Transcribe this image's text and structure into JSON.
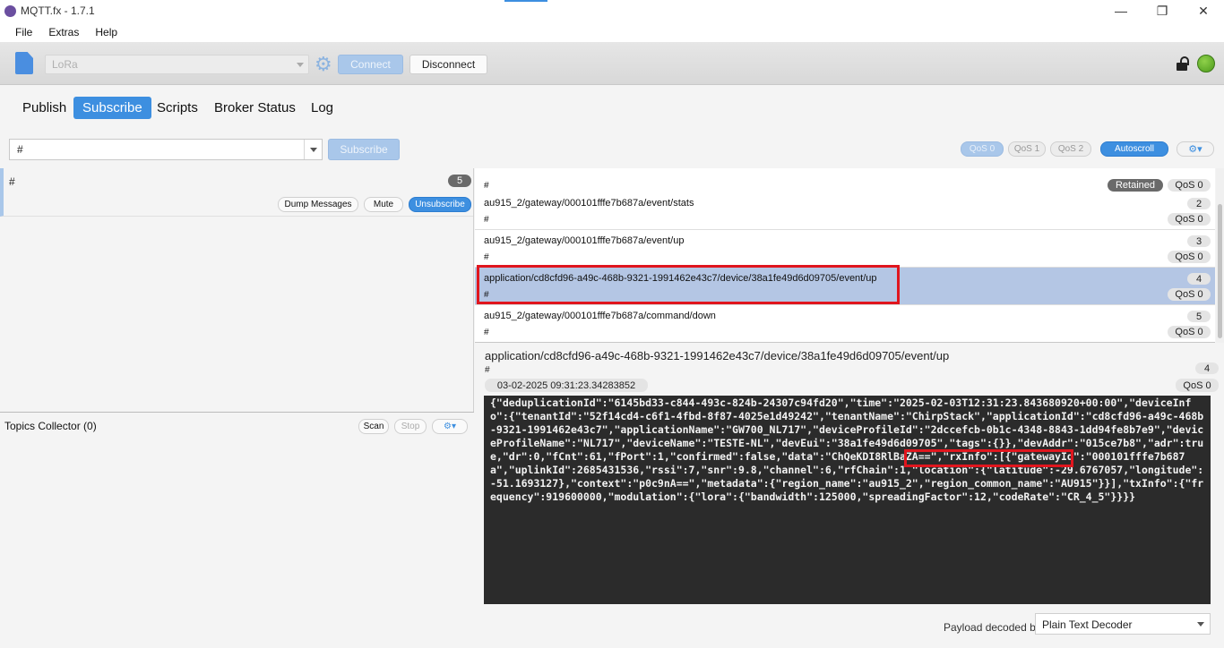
{
  "window": {
    "title": "MQTT.fx - 1.7.1"
  },
  "menu": {
    "items": [
      "File",
      "Extras",
      "Help"
    ]
  },
  "connection": {
    "profile": "LoRa",
    "connect_label": "Connect",
    "disconnect_label": "Disconnect",
    "status_color": "#5aa828"
  },
  "tabs": [
    {
      "label": "Publish",
      "active": false
    },
    {
      "label": "Subscribe",
      "active": true
    },
    {
      "label": "Scripts",
      "active": false
    },
    {
      "label": "Broker Status",
      "active": false
    },
    {
      "label": "Log",
      "active": false
    }
  ],
  "subscribe_bar": {
    "topic_value": "#",
    "subscribe_label": "Subscribe",
    "qos0": "QoS 0",
    "qos1": "QoS 1",
    "qos2": "QoS 2",
    "autoscroll": "Autoscroll"
  },
  "subscriptions": [
    {
      "topic": "#",
      "count": "5",
      "dump": "Dump Messages",
      "mute": "Mute",
      "unsubscribe": "Unsubscribe"
    }
  ],
  "topics_collector": {
    "title": "Topics Collector (0)",
    "scan": "Scan",
    "stop": "Stop"
  },
  "messages": [
    {
      "topic": "",
      "sub": "#",
      "num": "",
      "qos": "QoS 0",
      "retained": "Retained"
    },
    {
      "topic": "au915_2/gateway/000101fffe7b687a/event/stats",
      "sub": "#",
      "num": "2",
      "qos": "QoS 0"
    },
    {
      "topic": "au915_2/gateway/000101fffe7b687a/event/up",
      "sub": "#",
      "num": "3",
      "qos": "QoS 0"
    },
    {
      "topic": "application/cd8cfd96-a49c-468b-9321-1991462e43c7/device/38a1fe49d6d09705/event/up",
      "sub": "#",
      "num": "4",
      "qos": "QoS 0",
      "selected": true
    },
    {
      "topic": "au915_2/gateway/000101fffe7b687a/command/down",
      "sub": "#",
      "num": "5",
      "qos": "QoS 0"
    }
  ],
  "detail": {
    "topic": "application/cd8cfd96-a49c-468b-9321-1991462e43c7/device/38a1fe49d6d09705/event/up",
    "sub": "#",
    "num": "4",
    "timestamp": "03-02-2025  09:31:23.34283852",
    "qos": "QoS 0",
    "payload": "{\"deduplicationId\":\"6145bd33-c844-493c-824b-24307c94fd20\",\"time\":\"2025-02-03T12:31:23.843680920+00:00\",\"deviceInfo\":{\"tenantId\":\"52f14cd4-c6f1-4fbd-8f87-4025e1d49242\",\"tenantName\":\"ChirpStack\",\"applicationId\":\"cd8cfd96-a49c-468b-9321-1991462e43c7\",\"applicationName\":\"GW700_NL717\",\"deviceProfileId\":\"2dccefcb-0b1c-4348-8843-1dd94fe8b7e9\",\"deviceProfileName\":\"NL717\",\"deviceName\":\"TESTE-NL\",\"devEui\":\"38a1fe49d6d09705\",\"tags\":{}},\"devAddr\":\"015ce7b8\",\"adr\":true,\"dr\":0,\"fCnt\":61,\"fPort\":1,\"confirmed\":false,\"data\":\"ChQeKDI8RlBaZA==\",\"rxInfo\":[{\"gatewayId\":\"000101fffe7b687a\",\"uplinkId\":2685431536,\"rssi\":7,\"snr\":9.8,\"channel\":6,\"rfChain\":1,\"location\":{\"latitude\":-29.6767057,\"longitude\":-51.1693127},\"context\":\"p0c9nA==\",\"metadata\":{\"region_name\":\"au915_2\",\"region_common_name\":\"AU915\"}}],\"txInfo\":{\"frequency\":919600000,\"modulation\":{\"lora\":{\"bandwidth\":125000,\"spreadingFactor\":12,\"codeRate\":\"CR_4_5\"}}}}",
    "decoder_label": "Payload decoded by",
    "decoder": "Plain Text Decoder"
  },
  "colors": {
    "accent": "#3d8fe0",
    "highlight": "#e0161e",
    "selected_row": "#b4c6e4"
  }
}
